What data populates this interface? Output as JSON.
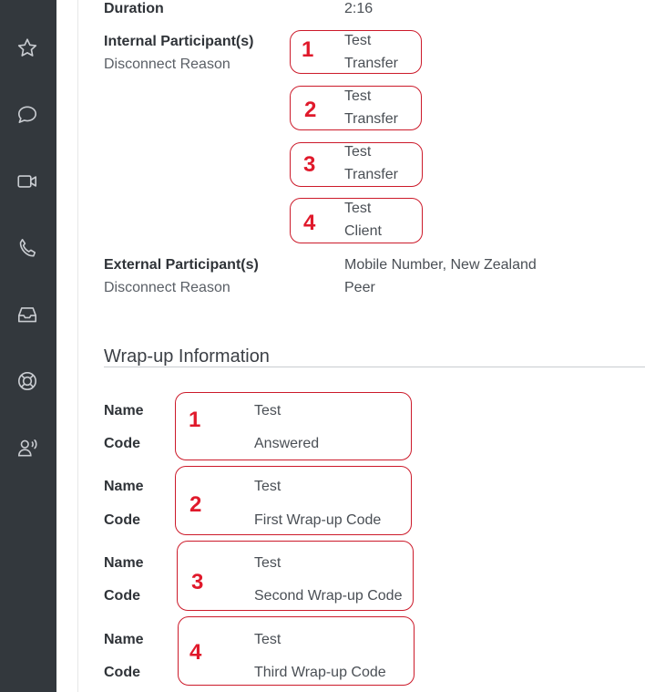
{
  "sidebar": {
    "icons": [
      "star-icon",
      "chat-bubble-icon",
      "video-icon",
      "phone-icon",
      "inbox-icon",
      "lifebuoy-icon",
      "voice-agent-icon"
    ]
  },
  "call_details": {
    "duration_label": "Duration",
    "duration_value": "2:16",
    "internal_label": "Internal Participant(s)",
    "internal_sub_label": "Disconnect Reason",
    "internal_participants": [
      {
        "marker": "1",
        "name": "Test",
        "reason": "Transfer"
      },
      {
        "marker": "2",
        "name": "Test",
        "reason": "Transfer"
      },
      {
        "marker": "3",
        "name": "Test",
        "reason": "Transfer"
      },
      {
        "marker": "4",
        "name": "Test",
        "reason": "Client"
      }
    ],
    "external_label": "External Participant(s)",
    "external_sub_label": "Disconnect Reason",
    "external_value": "Mobile Number, New Zealand",
    "external_reason": "Peer"
  },
  "wrapup": {
    "title": "Wrap-up Information",
    "name_label": "Name",
    "code_label": "Code",
    "entries": [
      {
        "marker": "1",
        "name": "Test",
        "code": "Answered"
      },
      {
        "marker": "2",
        "name": "Test",
        "code": "First Wrap-up Code"
      },
      {
        "marker": "3",
        "name": "Test",
        "code": "Second Wrap-up Code"
      },
      {
        "marker": "4",
        "name": "Test",
        "code": "Third Wrap-up Code"
      }
    ]
  },
  "colors": {
    "sidebar": "#33383d",
    "annotation": "#cc1a2a",
    "annotation_number": "#e0192b"
  }
}
